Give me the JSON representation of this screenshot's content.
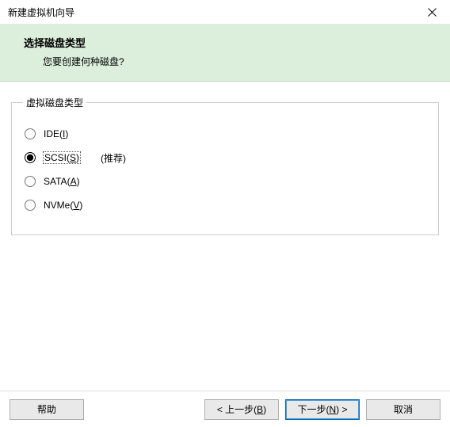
{
  "window": {
    "title": "新建虚拟机向导"
  },
  "header": {
    "heading": "选择磁盘类型",
    "subheading": "您要创建何种磁盘?"
  },
  "group": {
    "legend": "虚拟磁盘类型",
    "options": [
      {
        "label": "IDE",
        "hotkey": "I",
        "selected": false,
        "recommended": false
      },
      {
        "label": "SCSI",
        "hotkey": "S",
        "selected": true,
        "recommended": true
      },
      {
        "label": "SATA",
        "hotkey": "A",
        "selected": false,
        "recommended": false
      },
      {
        "label": "NVMe",
        "hotkey": "V",
        "selected": false,
        "recommended": false
      }
    ],
    "recommended_label": "(推荐)"
  },
  "buttons": {
    "help": {
      "text": "帮助"
    },
    "back": {
      "text": "< 上一步",
      "hotkey": "B"
    },
    "next": {
      "text": "下一步",
      "hotkey": "N",
      "suffix": " >"
    },
    "cancel": {
      "text": "取消"
    }
  }
}
